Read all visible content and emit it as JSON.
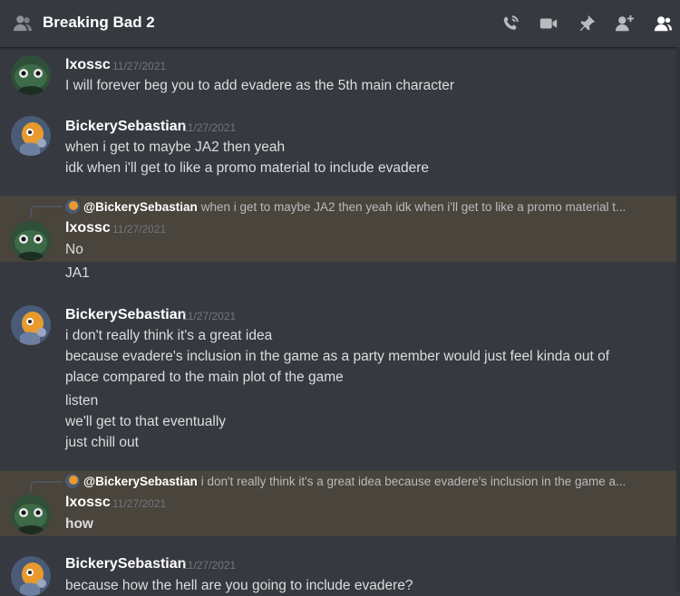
{
  "header": {
    "title": "Breaking Bad 2",
    "icons": [
      "members-group-icon",
      "voice-call-icon",
      "video-call-icon",
      "pin-icon",
      "add-friend-icon",
      "member-list-icon"
    ]
  },
  "messages": [
    {
      "user": "lxossc",
      "time": "11/27/2021",
      "lines": [
        "I will forever beg you to add evadere as the 5th main character"
      ]
    },
    {
      "user": "BickerySebastian",
      "time": "11/27/2021",
      "lines": [
        "when i get to maybe JA2 then yeah",
        "idk when i'll get to like a promo material to include evadere"
      ]
    },
    {
      "reply_to": {
        "name": "@BickerySebastian",
        "text": "when i get to maybe JA2 then yeah idk when i'll get to like a promo material t..."
      },
      "user": "lxossc",
      "time": "11/27/2021",
      "lines": [
        "No",
        "JA1"
      ]
    },
    {
      "user": "BickerySebastian",
      "time": "11/27/2021",
      "lines": [
        "i don't really think it's a great idea",
        "because evadere's inclusion in the game as a party member would just feel kinda out of",
        "place compared to the main plot of the game",
        "listen",
        "we'll get to that eventually",
        "just chill out"
      ]
    },
    {
      "reply_to": {
        "name": "@BickerySebastian",
        "text": "i don't really think it's a great idea because evadere's inclusion in the game a..."
      },
      "user": "lxossc",
      "time": "11/27/2021",
      "lines": [
        "how"
      ]
    },
    {
      "user": "BickerySebastian",
      "time": "11/27/2021",
      "lines": [
        "because how the hell are you going to include evadere?"
      ]
    }
  ],
  "colors": {
    "background": "#36393f",
    "highlight": "#49443c",
    "username": "#ffffff",
    "timestamp": "#72767d",
    "text": "#dcddde"
  }
}
